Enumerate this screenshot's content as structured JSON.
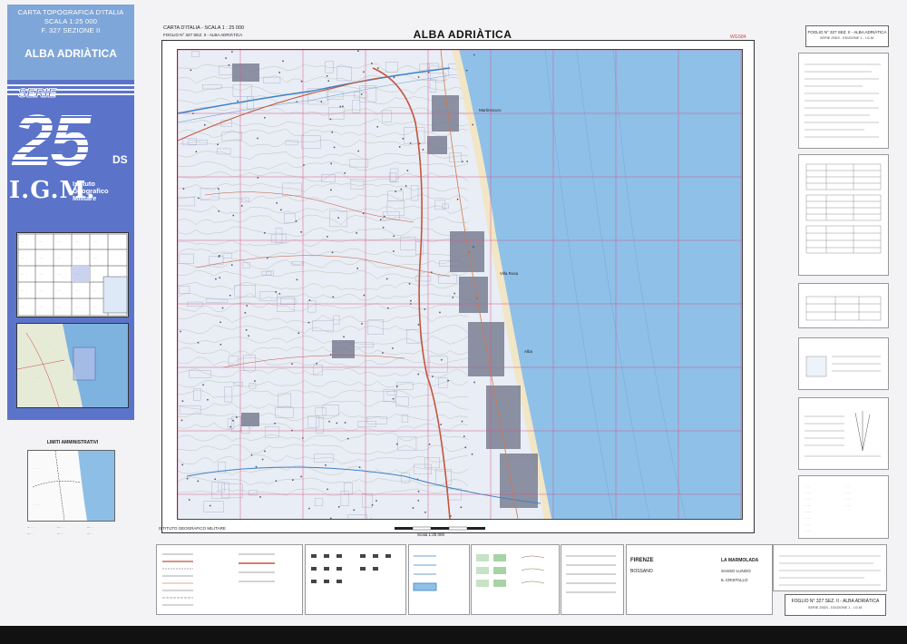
{
  "cover": {
    "lines": [
      "CARTA TOPOGRAFICA D'ITALIA",
      "SCALA 1:25 000",
      "F. 327 SEZIONE II"
    ],
    "sheet_name": "ALBA ADRIÀTICA",
    "serie_word": "SERIE",
    "serie_number": "25",
    "serie_suffix": "DS",
    "igm_letters": "I.G.M.",
    "igm_full": [
      "Istituto",
      "Geografico",
      "Militare"
    ]
  },
  "header": {
    "left_line1": "CARTA D'ITALIA - SCALA 1 : 25 000",
    "left_line2": "FOGLIO N° 327 SEZ. II - ALBA ADRIÀTICA",
    "title": "ALBA ADRIÀTICA",
    "code": "WGS84"
  },
  "map": {
    "labels": [
      "Martinsicuro",
      "Villa Rosa",
      "Alba"
    ],
    "sea_color": "#8fc0e8",
    "land_color": "#e9edf5",
    "road_color": "#c4553a",
    "grid_color": "#d4588a"
  },
  "legend": {
    "institute": "ISTITUTO GEOGRAFICO MILITARE",
    "scale_text": "Scala 1:25 000",
    "place_names": [
      "FIRENZE",
      "BOSSANO",
      "LA MARMOLADA",
      "SASSO LUNGO",
      "IL CRISTALLO"
    ]
  },
  "right_panel": {
    "top_title": "FOGLIO N° 327 SEZ. II - ALBA ADRIÀTICA",
    "top_sub": "SERIE 25DS - EDIZIONE 1 - I.G.M.",
    "bottom_title": "FOGLIO N° 327 SEZ. II - ALBA ADRIÀTICA",
    "bottom_sub": "SERIE 25DS - EDIZIONE 1 - I.G.M."
  },
  "limits": {
    "title": "LIMITI AMMINISTRATIVI"
  }
}
